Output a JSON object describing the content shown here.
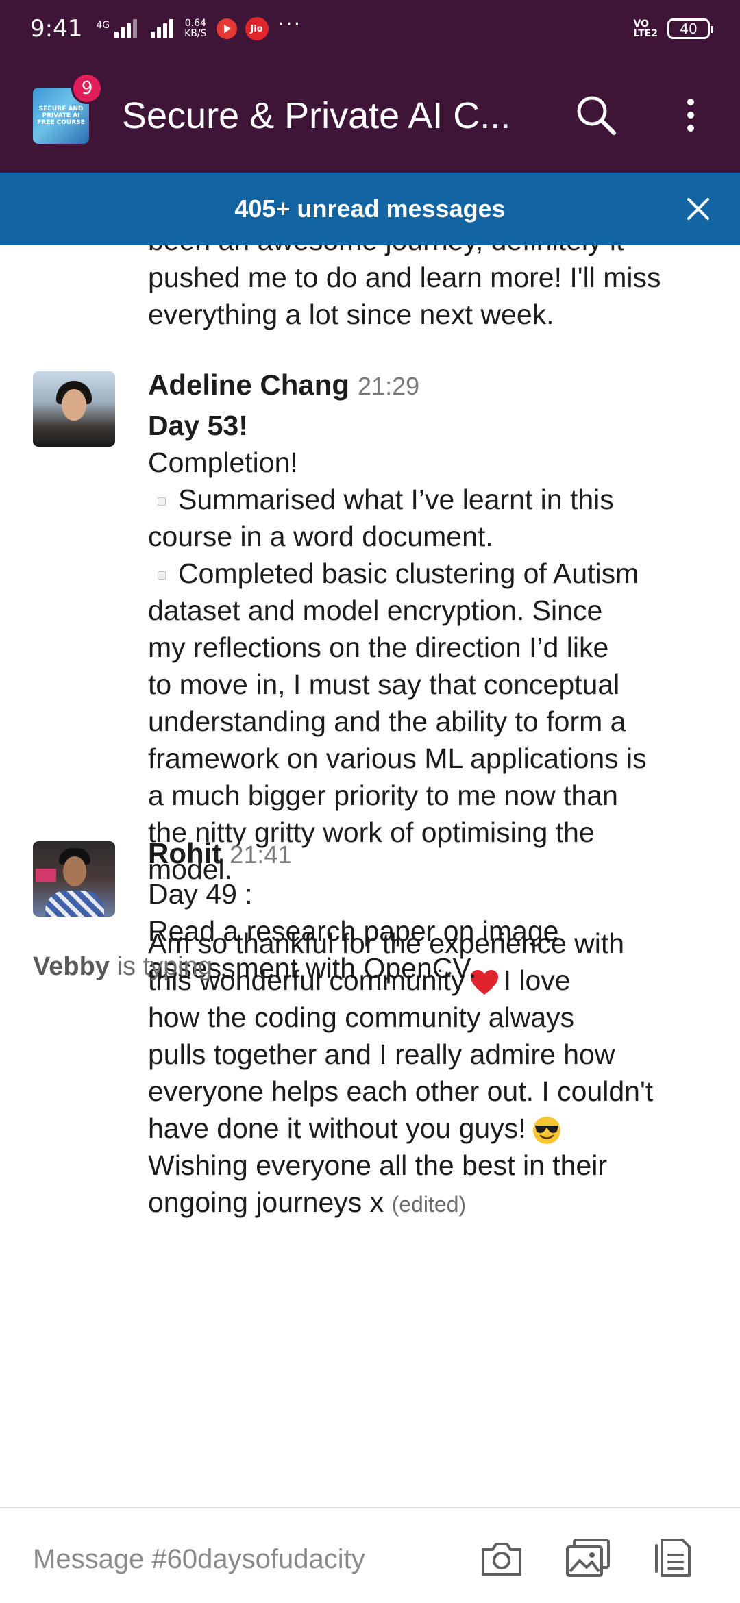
{
  "status_bar": {
    "time": "9:41",
    "network_label": "4G",
    "speed_value": "0.64",
    "speed_unit": "KB/S",
    "jio_label": "Jio",
    "more": "···",
    "volte_top": "VO",
    "volte_bottom": "LTE2",
    "battery": "40"
  },
  "header": {
    "channel_title": "Secure & Private AI C...",
    "thumbnail_text": "SECURE AND PRIVATE AI FREE COURSE",
    "notification_count": "9",
    "search_icon": "search-icon",
    "menu_icon": "more-vertical-icon"
  },
  "banner": {
    "text": "405+ unread messages",
    "close_icon": "close-icon"
  },
  "partial_message": {
    "lines": [
      "been an awesome journey, definitely it",
      "pushed me to do and learn more! I'll miss",
      "everything a lot since next week."
    ]
  },
  "messages": [
    {
      "author": "Adeline Chang",
      "time": "21:29",
      "title": "Day 53!",
      "intro": "Completion!",
      "bullet1": [
        "Summarised what I’ve learnt in this",
        "course in a word document."
      ],
      "bullet2": [
        "Completed basic clustering of Autism",
        "dataset and model encryption. Since",
        "my reflections on the direction I’d like",
        "to move in, I must say that conceptual",
        "understanding and the ability to form a",
        "framework on various ML applications is",
        "a much bigger priority to me now than",
        "the nitty gritty work of optimising the",
        "model."
      ],
      "para2": {
        "l1": "Am so thankful for the experience with",
        "l2a": "this wonderful community",
        "l2b": "I love",
        "l3": "how the coding community always",
        "l4": "pulls together and I really admire how",
        "l5": "everyone helps each other out. I couldn't",
        "l6": "have done it without you guys!",
        "l7": "Wishing everyone all the best in their",
        "l8": "ongoing journeys x"
      },
      "edited": "(edited)",
      "heart_icon": "red-heart-icon",
      "sunglasses_icon": "smiling-face-with-sunglasses-icon"
    },
    {
      "author": "Rohit",
      "time": "21:41",
      "lines": [
        "Day 49 :",
        "Read a research paper on image",
        "assessment with OpenCV."
      ]
    }
  ],
  "typing": {
    "user": "Vebby",
    "text": "is typing"
  },
  "composer": {
    "placeholder": "Message #60daysofudacity",
    "camera_icon": "camera-icon",
    "gallery_icon": "image-gallery-icon",
    "files_icon": "files-icon"
  }
}
